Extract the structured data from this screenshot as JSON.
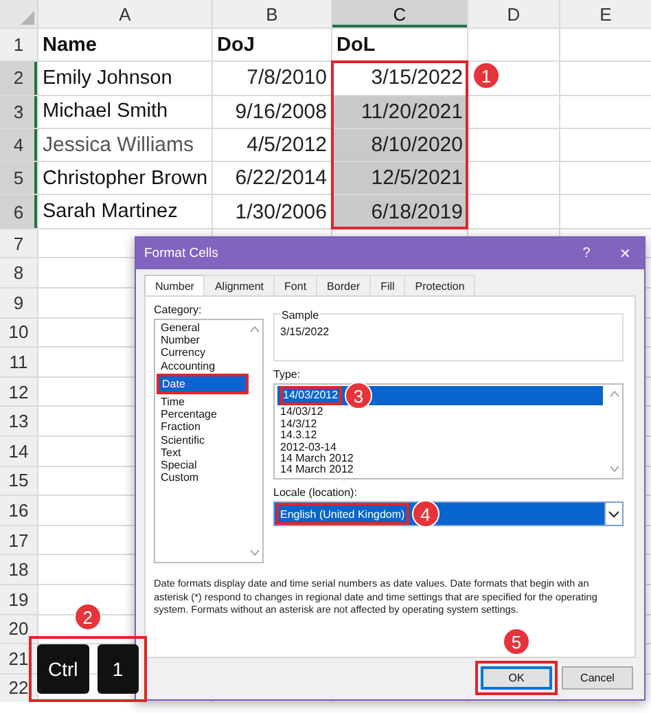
{
  "sheet": {
    "columns": [
      {
        "label": "A",
        "selected": false
      },
      {
        "label": "B",
        "selected": false
      },
      {
        "label": "C",
        "selected": true
      },
      {
        "label": "D",
        "selected": false
      },
      {
        "label": "E",
        "selected": false
      }
    ],
    "rows": [
      {
        "number": "1",
        "selected": false,
        "cells": [
          {
            "text": "Name",
            "kind": "header",
            "selected": false
          },
          {
            "text": "DoJ",
            "kind": "header",
            "selected": false
          },
          {
            "text": "DoL",
            "kind": "header",
            "selected": false
          }
        ]
      },
      {
        "number": "2",
        "selected": true,
        "cells": [
          {
            "text": "Emily Johnson",
            "kind": "text",
            "selected": false
          },
          {
            "text": "7/8/2010",
            "kind": "date",
            "selected": false
          },
          {
            "text": "3/15/2022",
            "kind": "date",
            "selected": false
          }
        ]
      },
      {
        "number": "3",
        "selected": true,
        "cells": [
          {
            "text": "Michael Smith",
            "kind": "text",
            "selected": false
          },
          {
            "text": "9/16/2008",
            "kind": "date",
            "selected": false
          },
          {
            "text": "11/20/2021",
            "kind": "date",
            "selected": true
          }
        ]
      },
      {
        "number": "4",
        "selected": true,
        "cells": [
          {
            "text": "Jessica Williams",
            "kind": "light",
            "selected": false
          },
          {
            "text": "4/5/2012",
            "kind": "date",
            "selected": false
          },
          {
            "text": "8/10/2020",
            "kind": "date",
            "selected": true
          }
        ]
      },
      {
        "number": "5",
        "selected": true,
        "cells": [
          {
            "text": "Christopher Brown",
            "kind": "text",
            "selected": false
          },
          {
            "text": "6/22/2014",
            "kind": "date",
            "selected": false
          },
          {
            "text": "12/5/2021",
            "kind": "date",
            "selected": true
          }
        ]
      },
      {
        "number": "6",
        "selected": true,
        "cells": [
          {
            "text": "Sarah Martinez",
            "kind": "text",
            "selected": false
          },
          {
            "text": "1/30/2006",
            "kind": "date",
            "selected": false
          },
          {
            "text": "6/18/2019",
            "kind": "date",
            "selected": true
          }
        ]
      },
      {
        "number": "7",
        "selected": false
      },
      {
        "number": "8",
        "selected": false
      },
      {
        "number": "9",
        "selected": false
      },
      {
        "number": "10",
        "selected": false
      },
      {
        "number": "11",
        "selected": false
      },
      {
        "number": "12",
        "selected": false
      },
      {
        "number": "13",
        "selected": false
      },
      {
        "number": "14",
        "selected": false
      },
      {
        "number": "15",
        "selected": false
      },
      {
        "number": "16",
        "selected": false
      },
      {
        "number": "17",
        "selected": false
      },
      {
        "number": "18",
        "selected": false
      },
      {
        "number": "19",
        "selected": false
      },
      {
        "number": "20",
        "selected": false
      },
      {
        "number": "21",
        "selected": false
      },
      {
        "number": "22",
        "selected": false
      }
    ]
  },
  "dialog": {
    "title": "Format Cells",
    "help": "?",
    "close": "✕",
    "tabs": [
      {
        "label": "Number",
        "selected": true
      },
      {
        "label": "Alignment",
        "selected": false
      },
      {
        "label": "Font",
        "selected": false
      },
      {
        "label": "Border",
        "selected": false
      },
      {
        "label": "Fill",
        "selected": false
      },
      {
        "label": "Protection",
        "selected": false
      }
    ],
    "category_label": "Category:",
    "categories": [
      {
        "label": "General",
        "selected": false
      },
      {
        "label": "Number",
        "selected": false
      },
      {
        "label": "Currency",
        "selected": false
      },
      {
        "label": "Accounting",
        "selected": false
      },
      {
        "label": "Date",
        "selected": true
      },
      {
        "label": "Time",
        "selected": false
      },
      {
        "label": "Percentage",
        "selected": false
      },
      {
        "label": "Fraction",
        "selected": false
      },
      {
        "label": "Scientific",
        "selected": false
      },
      {
        "label": "Text",
        "selected": false
      },
      {
        "label": "Special",
        "selected": false
      },
      {
        "label": "Custom",
        "selected": false
      }
    ],
    "sample_label": "Sample",
    "sample_value": "3/15/2022",
    "type_label": "Type:",
    "types": [
      {
        "label": "14/03/2012",
        "selected": true
      },
      {
        "label": "14/03/12",
        "selected": false
      },
      {
        "label": "14/3/12",
        "selected": false
      },
      {
        "label": "14.3.12",
        "selected": false
      },
      {
        "label": "2012-03-14",
        "selected": false
      },
      {
        "label": "14 March 2012",
        "selected": false
      },
      {
        "label": "14 March 2012",
        "selected": false
      }
    ],
    "locale_label": "Locale (location):",
    "locale_value": "English (United Kingdom)",
    "description": "Date formats display date and time serial numbers as date values.  Date formats that begin with an asterisk (*) respond to changes in regional date and time settings that are specified for the operating system. Formats without an asterisk are not affected by operating system settings.",
    "buttons": [
      {
        "label": "OK",
        "default": true
      },
      {
        "label": "Cancel",
        "default": false
      }
    ]
  },
  "keys": [
    "Ctrl",
    "1"
  ],
  "annotations": [
    "1",
    "2",
    "3",
    "4",
    "5"
  ]
}
